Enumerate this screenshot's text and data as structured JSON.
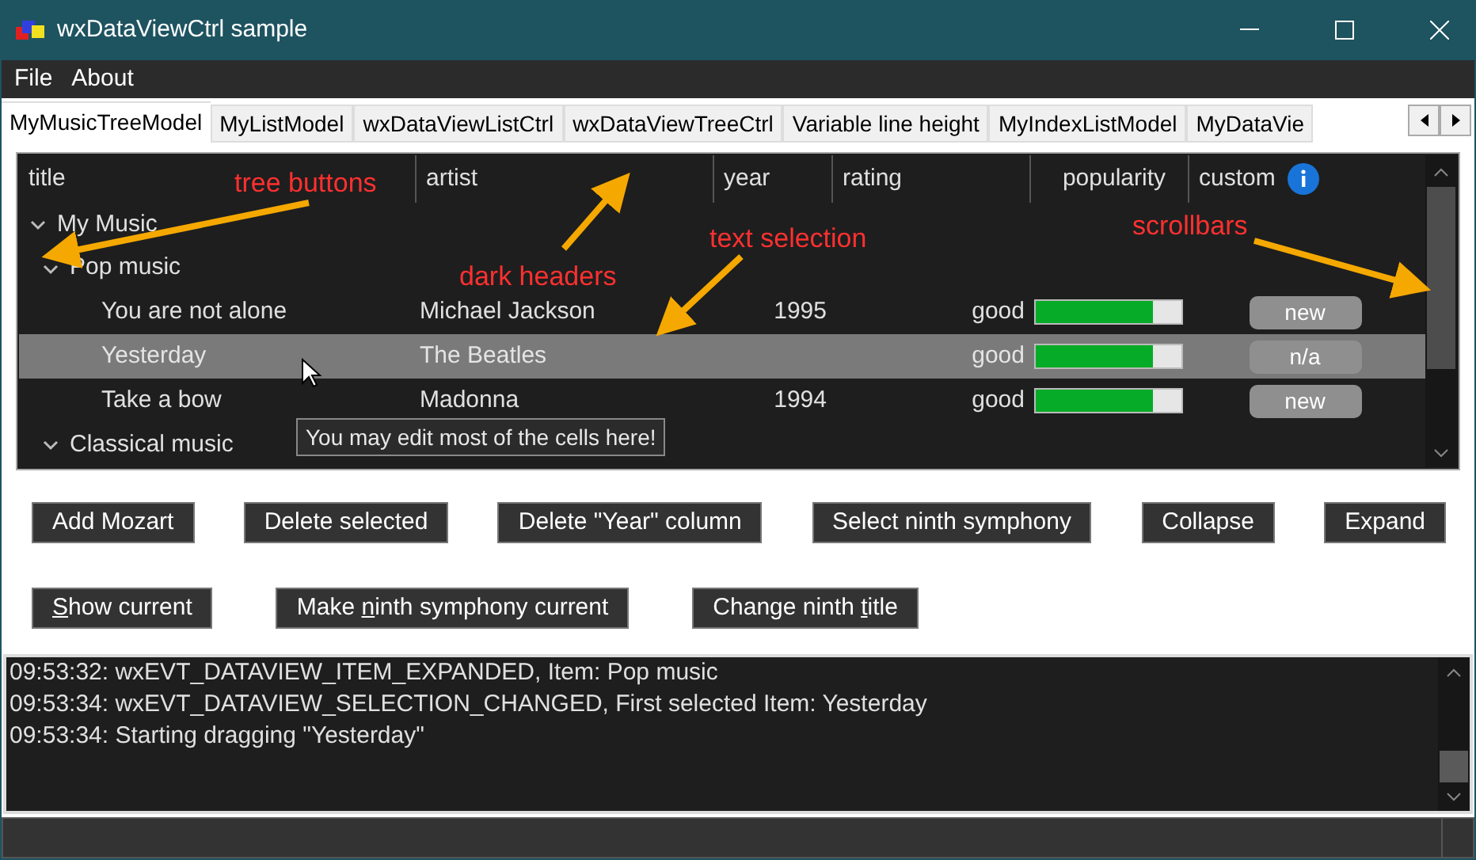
{
  "window": {
    "title": "wxDataViewCtrl sample"
  },
  "menu": [
    "File",
    "About"
  ],
  "tabs": [
    {
      "label": "MyMusicTreeModel",
      "selected": true
    },
    {
      "label": "MyListModel",
      "selected": false
    },
    {
      "label": "wxDataViewListCtrl",
      "selected": false
    },
    {
      "label": "wxDataViewTreeCtrl",
      "selected": false
    },
    {
      "label": "Variable line height",
      "selected": false
    },
    {
      "label": "MyIndexListModel",
      "selected": false
    },
    {
      "label": "MyDataVie",
      "selected": false
    }
  ],
  "table": {
    "columns": [
      "title",
      "artist",
      "year",
      "rating",
      "popularity",
      "custom"
    ],
    "rows": [
      {
        "title": "My Music",
        "expanded": true,
        "selected": false,
        "children": [
          {
            "title": "Pop music",
            "expanded": true,
            "selected": false,
            "children": [
              {
                "title": "You are not alone",
                "artist": "Michael Jackson",
                "year": "1995",
                "rating": "good",
                "level": 0.8,
                "custom": "new",
                "selected": false
              },
              {
                "title": "Yesterday",
                "artist": "The Beatles",
                "rating": "good",
                "level": 0.8,
                "custom": "n/a",
                "selected": true
              },
              {
                "title": "Take a bow",
                "artist": "Madonna",
                "year": "1994",
                "rating": "good",
                "level": 0.8,
                "custom": "new",
                "selected": false
              }
            ]
          },
          {
            "title": "Classical music",
            "expanded": true,
            "selected": false
          }
        ]
      }
    ]
  },
  "tooltip": "You may edit most of the cells here!",
  "annotations": [
    "tree buttons",
    "dark headers",
    "text selection",
    "scrollbars"
  ],
  "button_rows": [
    [
      {
        "before": "Add Mozart"
      },
      {
        "before": "Delete selected"
      },
      {
        "before": "Delete \"Year\" column"
      },
      {
        "before": "Select ninth symphony"
      },
      {
        "before": "Collapse"
      },
      {
        "before": "Expand"
      }
    ],
    [
      {
        "key": "S",
        "after": "how current"
      },
      {
        "before": "Make ",
        "key": "n",
        "after": "inth symphony current"
      },
      {
        "before": "Change ninth ",
        "key": "t",
        "after": "itle"
      }
    ]
  ],
  "log": [
    "09:53:32: wxEVT_DATAVIEW_ITEM_EXPANDED, Item: Pop music",
    "09:53:34: wxEVT_DATAVIEW_SELECTION_CHANGED, First selected Item: Yesterday",
    "09:53:34: Starting dragging \"Yesterday\""
  ]
}
